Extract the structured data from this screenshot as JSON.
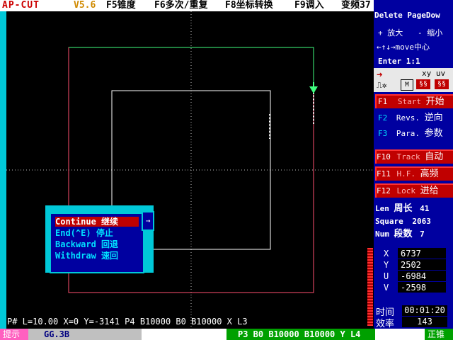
{
  "topbar": {
    "title": "AP-CUT",
    "version": "V5.6",
    "f5": "F5锥度",
    "f6": "F6多次/重复",
    "f8": "F8坐标转换",
    "f9": "F9调入",
    "extra": "变频37"
  },
  "panel": {
    "delete_pagedown": "Delete PageDow",
    "zoom_in": "+ 放大",
    "zoom_out": "- 缩小",
    "move_center": "←↑↓→move中心",
    "enter_scale": "Enter  1:1",
    "xy_uv": "xy uv",
    "f1_key": "F1",
    "f1_en": "Start",
    "f1_cn": "开始",
    "f2_key": "F2",
    "f2_en": "Revs.",
    "f2_cn": "逆向",
    "f3_key": "F3",
    "f3_en": "Para.",
    "f3_cn": "参数",
    "f10_key": "F10",
    "f10_en": "Track",
    "f10_cn": "自动",
    "f11_key": "F11",
    "f11_en": "H.F.",
    "f11_cn": "高频",
    "f12_key": "F12",
    "f12_en": "Lock",
    "f12_cn": "进给",
    "len_label": "Len",
    "len_cn": "周长",
    "len_value": "41",
    "square_label": "Square",
    "square_value": "2063",
    "num_label": "Num",
    "num_cn": "段数",
    "num_value": "7"
  },
  "coords": {
    "x_label": "X",
    "x_value": "6737",
    "y_label": "Y",
    "y_value": "2502",
    "u_label": "U",
    "u_value": "-6984",
    "v_label": "V",
    "v_value": "-2598",
    "time_label": "时间",
    "time_value": "00:01:20",
    "eff_label": "效率",
    "eff_value": "143"
  },
  "dialog": {
    "items": [
      {
        "en": "Continue",
        "cn": "继续"
      },
      {
        "en": "End(^E)",
        "cn": "停止"
      },
      {
        "en": "Backward",
        "cn": "回退"
      },
      {
        "en": "Withdraw",
        "cn": "速回"
      }
    ],
    "arrow": "→"
  },
  "status": {
    "line": "P# L=10.00  X=0       Y=-3141   P4 B10000 B0 B10000 X L3"
  },
  "bottom": {
    "hint": "提示",
    "file": "GG.3B",
    "program": "P3 B0 B10000 B10000 Y L4",
    "mode": "正锥"
  },
  "colors": {
    "panel_bg": "#0000a0",
    "accent_cyan": "#00c8d8",
    "fkey_red": "#ff3030",
    "outer_rect": "#ff5070",
    "inner_rect": "#ffffff",
    "trace_green": "#40ff80"
  }
}
